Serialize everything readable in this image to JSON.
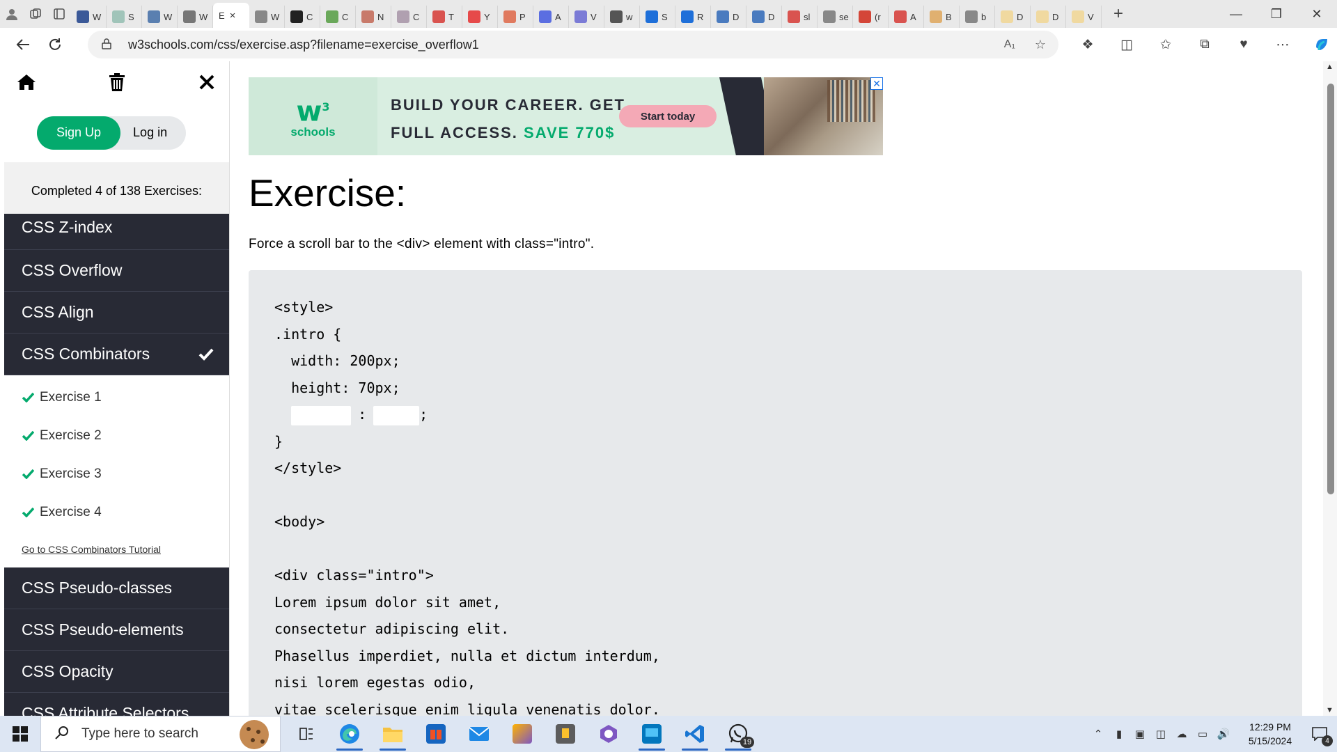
{
  "browser": {
    "url": "w3schools.com/css/exercise.asp?filename=exercise_overflow1",
    "tabs": [
      {
        "label": "W",
        "color": "#3b5998"
      },
      {
        "label": "S",
        "color": "#a0c4b9"
      },
      {
        "label": "W",
        "color": "#5a7fb0"
      },
      {
        "label": "W",
        "color": "#777777"
      },
      {
        "label": "E",
        "color": "#ffffff",
        "active": true
      },
      {
        "label": "W",
        "color": "#888888"
      },
      {
        "label": "C",
        "color": "#222222"
      },
      {
        "label": "C",
        "color": "#6aa85a"
      },
      {
        "label": "N",
        "color": "#c87a6a"
      },
      {
        "label": "C",
        "color": "#b0a0b0"
      },
      {
        "label": "T",
        "color": "#d9534f"
      },
      {
        "label": "Y",
        "color": "#e64a4a"
      },
      {
        "label": "P",
        "color": "#e07a5f"
      },
      {
        "label": "A",
        "color": "#5b6ee1"
      },
      {
        "label": "V",
        "color": "#7b7bd6"
      },
      {
        "label": "w",
        "color": "#555555"
      },
      {
        "label": "S",
        "color": "#1e6fd9"
      },
      {
        "label": "R",
        "color": "#1e6fd9"
      },
      {
        "label": "D",
        "color": "#4a7bbf"
      },
      {
        "label": "D",
        "color": "#4a7bbf"
      },
      {
        "label": "sl",
        "color": "#d9534f"
      },
      {
        "label": "se",
        "color": "#888888"
      },
      {
        "label": "(r",
        "color": "#d44638"
      },
      {
        "label": "A",
        "color": "#d9534f"
      },
      {
        "label": "B",
        "color": "#e0b070"
      },
      {
        "label": "b",
        "color": "#888888"
      },
      {
        "label": "D",
        "color": "#f0d9a0"
      },
      {
        "label": "D",
        "color": "#f0d9a0"
      },
      {
        "label": "V",
        "color": "#f0d9a0"
      }
    ],
    "active_tab_close": "×"
  },
  "sidebar": {
    "signup_label": "Sign Up",
    "login_label": "Log in",
    "progress_text": "Completed 4 of 138 Exercises:",
    "categories_before": [
      "CSS Z-index",
      "CSS Overflow",
      "CSS Align",
      "CSS Combinators"
    ],
    "exercises": [
      "Exercise 1",
      "Exercise 2",
      "Exercise 3",
      "Exercise 4"
    ],
    "tutorial_link": "Go to CSS Combinators Tutorial",
    "categories_after": [
      "CSS Pseudo-classes",
      "CSS Pseudo-elements",
      "CSS Opacity",
      "CSS Attribute Selectors"
    ]
  },
  "ad": {
    "logo_text": "schools",
    "logo_mark": "w",
    "logo_sup": "3",
    "headline_1": "BUILD YOUR CAREER. GET",
    "headline_2a": "FULL ACCESS.",
    "headline_2b": "SAVE 770$",
    "cta": "Start today"
  },
  "exercise": {
    "title": "Exercise:",
    "description": "Force a scroll bar to the <div> element with class=\"intro\".",
    "code_lines": [
      "<style>",
      ".intro {",
      "  width: 200px;",
      "  height: 70px;",
      "__BLANK__",
      "}",
      "</style>",
      "",
      "<body>",
      "",
      "<div class=\"intro\">",
      "Lorem ipsum dolor sit amet,",
      "consectetur adipiscing elit.",
      "Phasellus imperdiet, nulla et dictum interdum,",
      "nisi lorem egestas odio,",
      "vitae scelerisque enim ligula venenatis dolor."
    ],
    "blank_colon": ":",
    "blank_semicolon": ";"
  },
  "taskbar": {
    "search_placeholder": "Type here to search",
    "whatsapp_badge": "19",
    "time": "12:29 PM",
    "date": "5/15/2024",
    "notification_count": "4"
  },
  "colors": {
    "brand_green": "#04aa6d",
    "sidebar_dark": "#282a35",
    "code_bg": "#e7e9eb"
  }
}
